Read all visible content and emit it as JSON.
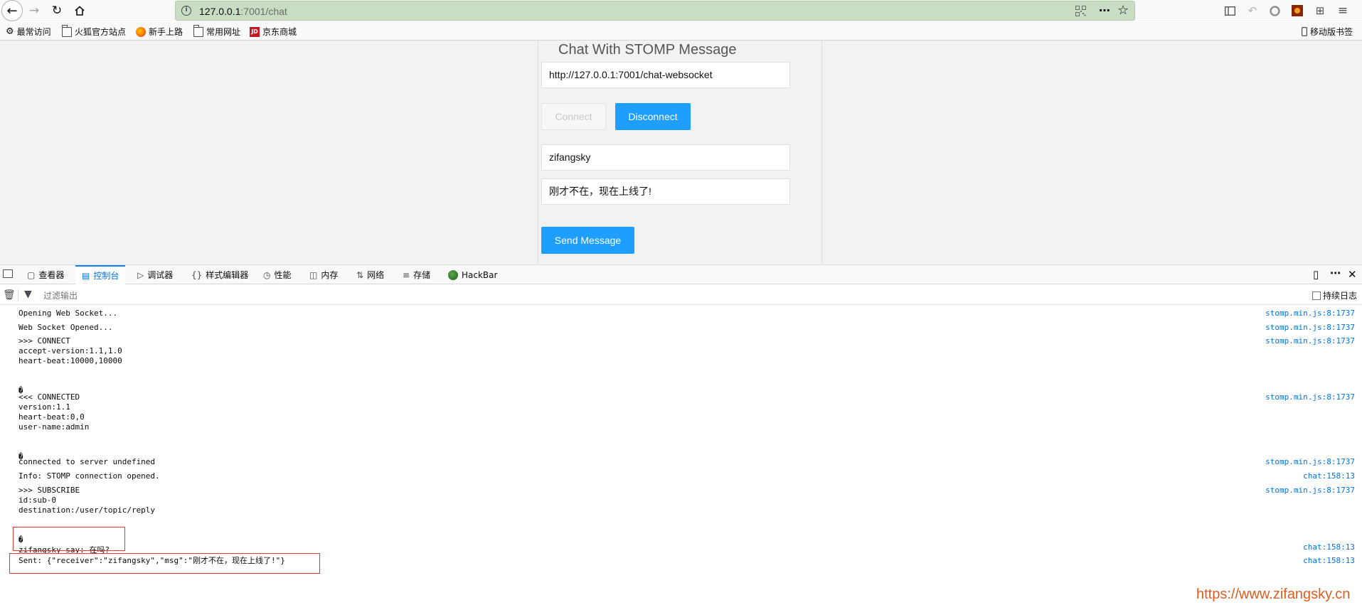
{
  "browser": {
    "url_host": "127.0.0.1",
    "url_rest": ":7001/chat",
    "icons": {
      "back": "arrow-left-icon",
      "forward": "arrow-right-icon",
      "reload": "reload-icon",
      "home": "home-icon",
      "more": "more-icon",
      "bookmark_star": "star-icon"
    }
  },
  "bookmarks": {
    "items": [
      "最常访问",
      "火狐官方站点",
      "新手上路",
      "常用网址",
      "京东商城"
    ],
    "mobile": "移动版书签"
  },
  "page": {
    "title": "Chat With STOMP Message",
    "ws_url": "http://127.0.0.1:7001/chat-websocket",
    "connect_label": "Connect",
    "disconnect_label": "Disconnect",
    "receiver_value": "zifangsky",
    "message_value": "刚才不在，现在上线了!",
    "send_label": "Send Message",
    "accent_color": "#1e9fff"
  },
  "devtools": {
    "tabs": [
      "查看器",
      "控制台",
      "调试器",
      "样式编辑器",
      "性能",
      "内存",
      "网络",
      "存储",
      "HackBar"
    ],
    "active_tab": "控制台",
    "filter_placeholder": "过滤输出",
    "persist_label": "持续日志"
  },
  "console": {
    "messages": [
      {
        "text": "Opening Web Socket...",
        "source": "stomp.min.js:8:1737"
      },
      {
        "text": "Web Socket Opened...",
        "source": "stomp.min.js:8:1737"
      },
      {
        "text": ">>> CONNECT\naccept-version:1.1,1.0\nheart-beat:10000,10000\n\n\n�",
        "source": "stomp.min.js:8:1737"
      },
      {
        "text": "<<< CONNECTED\nversion:1.1\nheart-beat:0,0\nuser-name:admin\n\n\n�",
        "source": "stomp.min.js:8:1737"
      },
      {
        "text": "connected to server undefined",
        "source": "stomp.min.js:8:1737"
      },
      {
        "text": "Info: STOMP connection opened.",
        "source": "chat:158:13"
      },
      {
        "text": ">>> SUBSCRIBE\nid:sub-0\ndestination:/user/topic/reply\n\n\n�\nzifangsky say: 在吗?",
        "source": "stomp.min.js:8:1737"
      },
      {
        "text": "",
        "source": "chat:158:13"
      },
      {
        "text": "Sent: {\"receiver\":\"zifangsky\",\"msg\":\"刚才不在，现在上线了!\"}",
        "source": "chat:158:13"
      }
    ]
  },
  "watermark": "https://www.zifangsky.cn"
}
